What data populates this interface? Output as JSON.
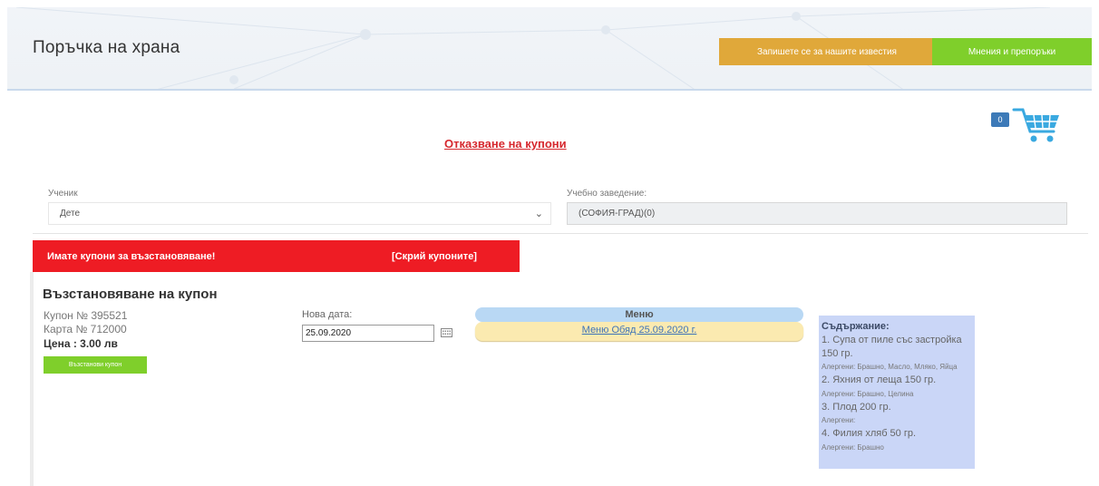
{
  "header": {
    "title": "Поръчка на храна",
    "subscribe_label": "Запишете се за нашите известия",
    "reviews_label": "Мнения и препоръки"
  },
  "cart": {
    "count": "0"
  },
  "cancel_link": "Отказване на купони",
  "form": {
    "student_label": "Ученик",
    "student_value": "Дете",
    "school_label": "Учебно заведение:",
    "school_value": "(СОФИЯ-ГРАД)(0)"
  },
  "banner": {
    "message": "Имате купони за възстановяване!",
    "hide_label": "[Скрий купоните]"
  },
  "restore": {
    "title": "Възстановяване на купон",
    "coupon": "Купон № 395521",
    "card": "Карта № 712000",
    "price": "Цена : 3.00 лв",
    "button_label": "Възстанови купон",
    "new_date_label": "Нова дата:",
    "new_date_value": "25.09.2020",
    "menu_header": "Меню",
    "menu_link": "Меню Обяд 25.09.2020 г."
  },
  "contents": {
    "title": "Съдържание:",
    "items": [
      {
        "dish": "1. Супа от пиле със застройка 150 гр.",
        "allergens": "Алергени: Брашно, Масло, Мляко, Яйца"
      },
      {
        "dish": "2. Яхния от леща 150 гр.",
        "allergens": "Алергени: Брашно, Целина"
      },
      {
        "dish": "3. Плод 200 гр.",
        "allergens": "Алергени:"
      },
      {
        "dish": "4. Филия хляб 50 гр.",
        "allergens": "Алергени: Брашно"
      }
    ]
  },
  "colors": {
    "subscribe": "#e0a83a",
    "reviews": "#7fcf2b",
    "banner": "#ee1c24",
    "link": "#d6282e",
    "cart": "#3aa9e0",
    "badge": "#3d7ab8"
  },
  "icons": [
    "cart-icon",
    "calendar-icon",
    "chevron-down-icon"
  ]
}
